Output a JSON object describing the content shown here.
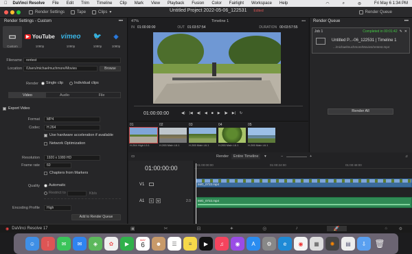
{
  "menubar": {
    "apple": "",
    "app": "DaVinci Resolve",
    "items": [
      "File",
      "Edit",
      "Trim",
      "Timeline",
      "Clip",
      "Mark",
      "View",
      "Playback",
      "Fusion",
      "Color",
      "Fairlight",
      "Workspace",
      "Help"
    ],
    "clock": "Fri May 6  1:34 PM"
  },
  "topbar": {
    "render_settings": "Render Settings",
    "tape": "Tape",
    "clips": "Clips",
    "project_title": "Untitled Project 2022-05-06_122531",
    "edited": "Edited",
    "render_queue_btn": "Render Queue"
  },
  "left_panel": {
    "title": "Render Settings - Custom",
    "presets": [
      {
        "icon": "custom-icon",
        "label": "Custom",
        "glyph": "▭"
      },
      {
        "icon": "youtube-icon",
        "label": "1080p",
        "glyph": "YouTube"
      },
      {
        "icon": "vimeo-icon",
        "label": "1080p",
        "glyph": "vimeo"
      },
      {
        "icon": "twitter-icon",
        "label": "1080p",
        "glyph": "🐦"
      },
      {
        "icon": "dropbox-icon",
        "label": "1080p",
        "glyph": "◈"
      }
    ],
    "filename_label": "Filename",
    "filename_value": "rentest",
    "location_label": "Location",
    "location_value": "/Users/michaelmuchmore/Movies",
    "browse": "Browse",
    "render_label": "Render",
    "single_clip": "Single clip",
    "individual_clips": "Individual clips",
    "tabs": [
      "Video",
      "Audio",
      "File"
    ],
    "export_video": "Export Video",
    "format_label": "Format",
    "format_value": "MP4",
    "codec_label": "Codec",
    "codec_value": "H.264",
    "hw_accel": "Use hardware acceleration if available",
    "network_opt": "Network Optimization",
    "resolution_label": "Resolution",
    "resolution_value": "1920 x 1080 HD",
    "framerate_label": "Frame rate",
    "framerate_value": "60",
    "chapters": "Chapters from Markers",
    "quality_label": "Quality",
    "automatic": "Automatic",
    "restrict_to": "Restrict to",
    "kbs": "Kb/s",
    "encoding_profile_label": "Encoding Profile",
    "encoding_profile_value": "High",
    "add_to_queue": "Add to Render Queue"
  },
  "viewer": {
    "zoom": "47%",
    "timeline_name": "Timeline 1",
    "in_label": "IN",
    "in_tc": "01:00:00:00",
    "out_label": "OUT",
    "out_tc": "01:03:57:54",
    "duration_label": "DURATION",
    "duration_tc": "00:03:57:55",
    "timecode": "01:00:00:00"
  },
  "render_queue": {
    "title": "Render Queue",
    "job_label": "Job 1",
    "job_status": "Completed in 00:01:42",
    "job_title": "Untitled P...-06_122531 | Timeline 1",
    "job_path": ".../michaelmuchmore/Movies/rentest.mp4",
    "render_all": "Render All"
  },
  "clips": [
    {
      "num": "01",
      "codec": "H.264 High L5.1"
    },
    {
      "num": "02",
      "codec": "H.265 Main L6.1"
    },
    {
      "num": "03",
      "codec": "H.265 Main L6.1"
    },
    {
      "num": "04",
      "codec": "H.265 Main L6.1"
    },
    {
      "num": "05",
      "codec": "H.265 Main L6.1"
    }
  ],
  "timeline": {
    "timecode": "01:00:00:00",
    "render_label": "Render",
    "render_mode": "Entire Timeline",
    "ruler_marks": [
      "01:00:00:00",
      "01:00:24:00",
      "01:00:48:00"
    ],
    "v1": "V1",
    "a1": "A1",
    "a1_value": "2.0",
    "s_btn": "S",
    "m_btn": "M",
    "video_clip": "IMG_0722.mp4",
    "audio_clip": "IMG_0722.mp4"
  },
  "bottom": {
    "app_name": "DaVinci Resolve 17"
  },
  "dock": {
    "calendar_month": "MAY",
    "calendar_day": "6"
  }
}
